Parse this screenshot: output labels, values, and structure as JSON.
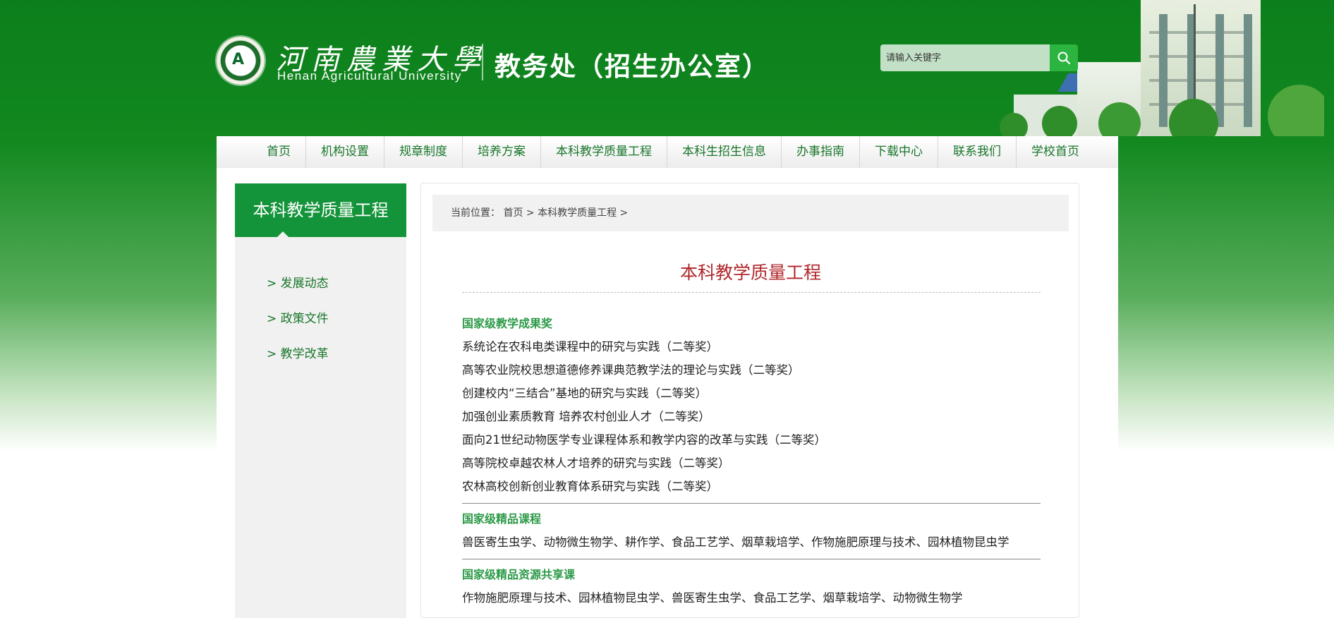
{
  "header": {
    "logo_glyph": "A",
    "university_cn": "河南農業大學",
    "university_en": "Henan Agricultural University",
    "office": "教务处（招生办公室）",
    "search_placeholder": "请输入关键字"
  },
  "nav": {
    "items": [
      "首页",
      "机构设置",
      "规章制度",
      "培养方案",
      "本科教学质量工程",
      "本科生招生信息",
      "办事指南",
      "下载中心",
      "联系我们",
      "学校首页"
    ]
  },
  "sidebar": {
    "title": "本科教学质量工程",
    "items": [
      "> 发展动态",
      "> 政策文件",
      "> 教学改革"
    ]
  },
  "breadcrumb": {
    "label": "当前位置：",
    "path": [
      "首页",
      "本科教学质量工程"
    ],
    "sep": ">"
  },
  "article": {
    "title": "本科教学质量工程",
    "sections": [
      {
        "heading": "国家级教学成果奖",
        "lines": [
          "系统论在农科电类课程中的研究与实践（二等奖）",
          "高等农业院校思想道德修养课典范教学法的理论与实践（二等奖）",
          "创建校内“三结合”基地的研究与实践（二等奖）",
          "加强创业素质教育 培养农村创业人才（二等奖）",
          "面向21世纪动物医学专业课程体系和教学内容的改革与实践（二等奖）",
          "高等院校卓越农林人才培养的研究与实践（二等奖）",
          "农林高校创新创业教育体系研究与实践（二等奖）"
        ]
      },
      {
        "heading": "国家级精品课程",
        "lines": [
          "兽医寄生虫学、动物微生物学、耕作学、食品工艺学、烟草栽培学、作物施肥原理与技术、园林植物昆虫学"
        ]
      },
      {
        "heading": "国家级精品资源共享课",
        "lines": [
          "作物施肥原理与技术、园林植物昆虫学、兽医寄生虫学、食品工艺学、烟草栽培学、动物微生物学"
        ]
      }
    ]
  },
  "colors": {
    "brand_green": "#14943a",
    "nav_text": "#18762a",
    "section_heading": "#2c9a48",
    "title_red": "#b2272a",
    "search_button": "#2cb441"
  },
  "icons": {
    "search": "search-icon"
  }
}
